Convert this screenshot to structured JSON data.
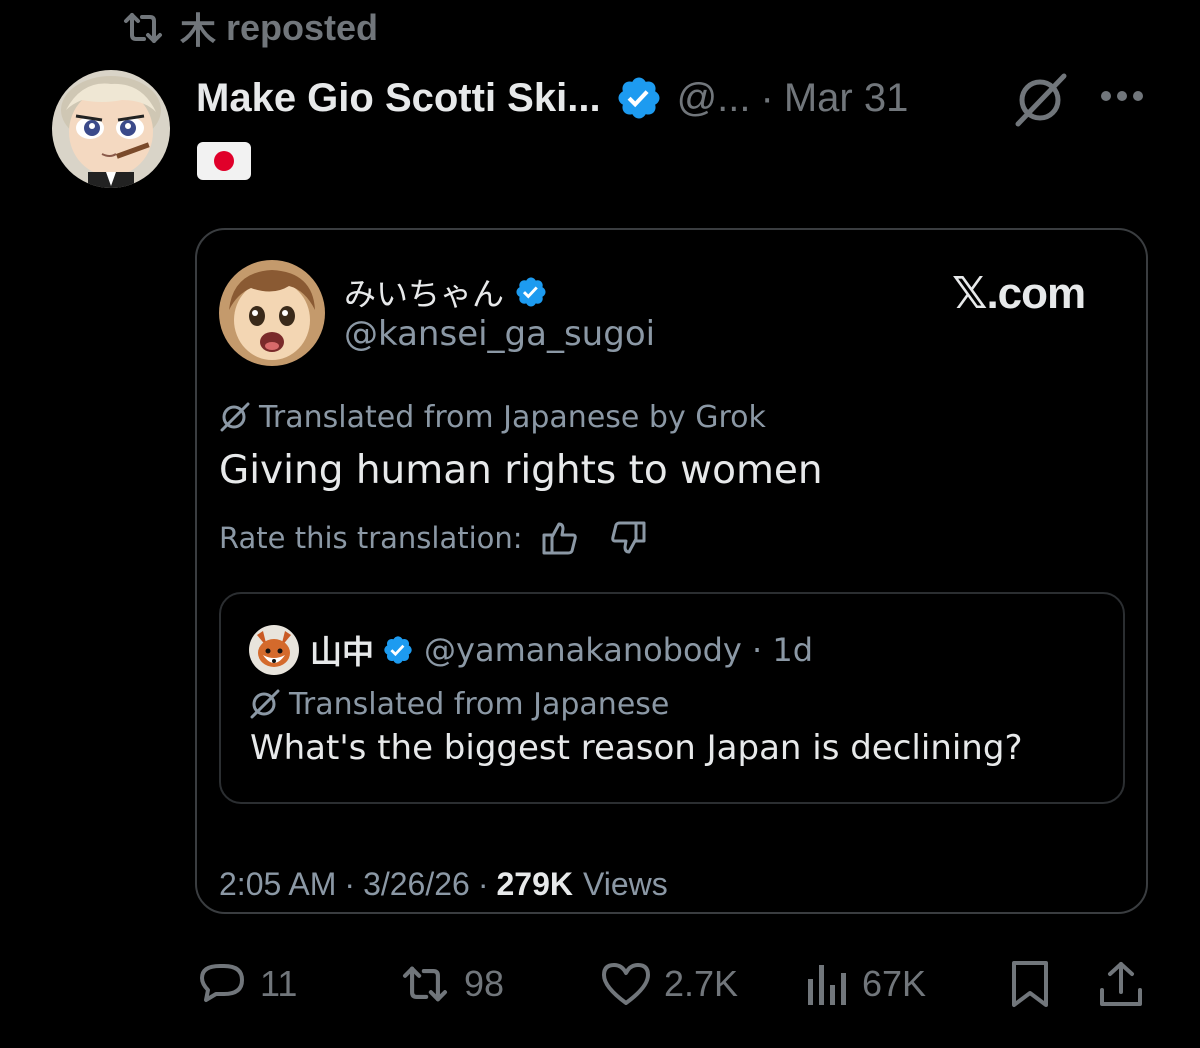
{
  "repost": {
    "icon": "repost-icon",
    "user_initial": "木",
    "label": "reposted"
  },
  "post": {
    "display_name": "Make Gio Scotti Ski...",
    "handle": "@...",
    "separator": "·",
    "date": "Mar 31",
    "flag_emoji": "Japan flag",
    "avatar": "anime-character-avatar"
  },
  "card": {
    "author_name": "みいちゃん",
    "author_handle": "@kansei_ga_sugoi",
    "brand": "𝕏.com",
    "translation_note": "Translated from Japanese by Grok",
    "text": "Giving human rights to women",
    "rate_label": "Rate this translation:",
    "quoted": {
      "name": "山中",
      "handle": "@yamanakanobody · 1d",
      "translation_note": "Translated from Japanese",
      "text": "What's the biggest reason Japan is declining?"
    },
    "time": "2:05 AM",
    "sep1": "·",
    "date": "3/26/26",
    "sep2": "·",
    "views_count": "279K",
    "views_label": "Views"
  },
  "actions": {
    "replies": "11",
    "reposts": "98",
    "likes": "2.7K",
    "views": "67K"
  },
  "colors": {
    "background": "#000000",
    "text": "#e7e9ea",
    "muted": "#71767b",
    "verified": "#1d9bf0"
  }
}
